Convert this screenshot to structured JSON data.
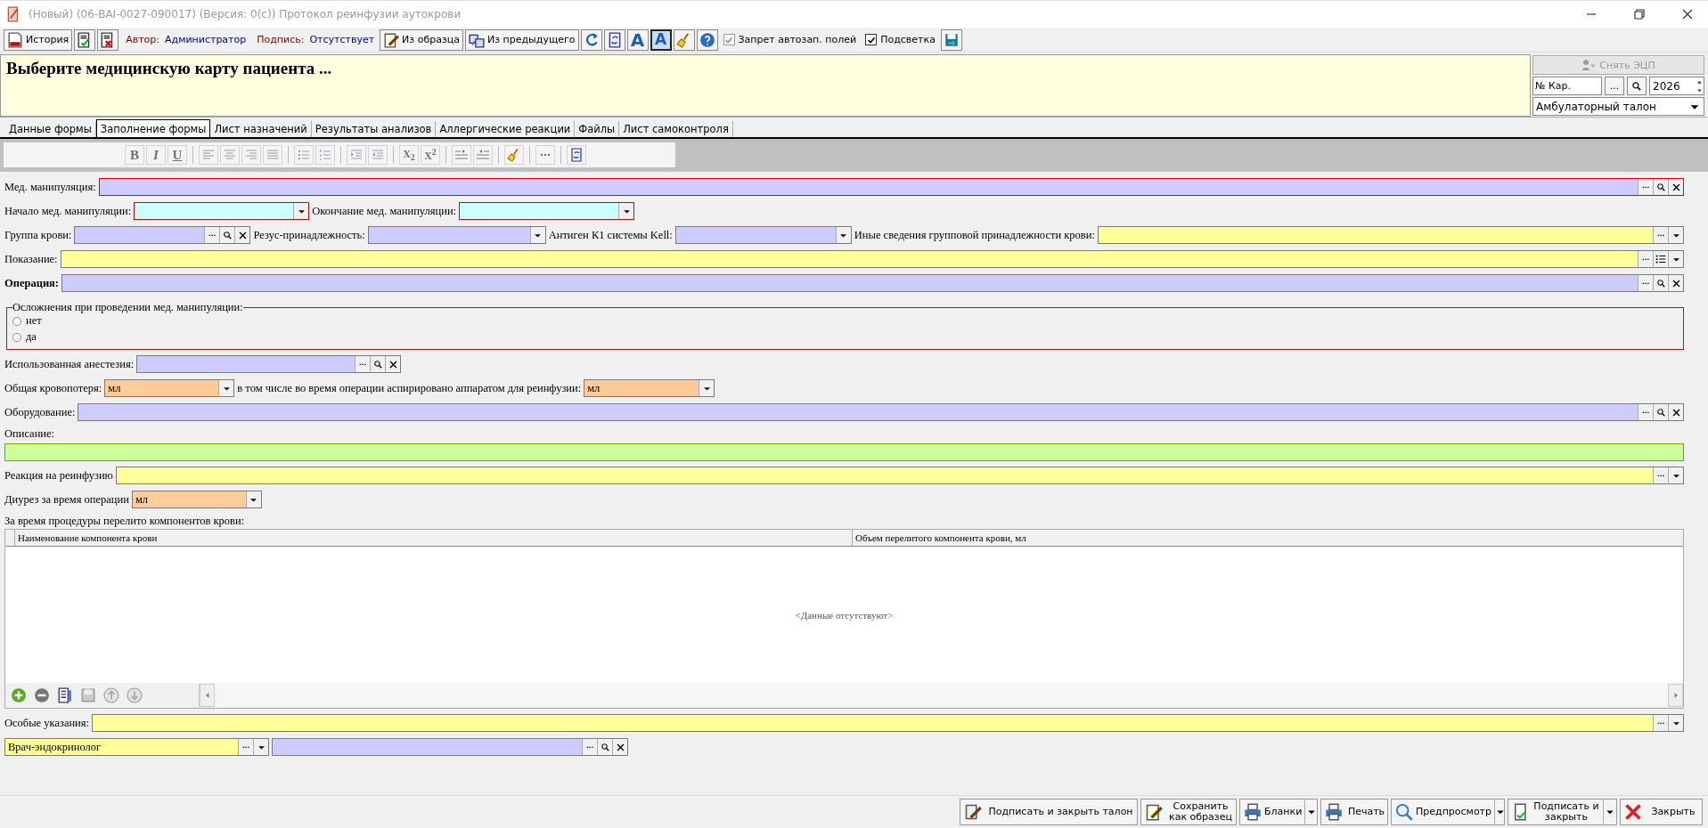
{
  "window": {
    "title": "(Новый) (06-BAI-0027-090017) (Версия: 0(с)) Протокол реинфузии аутокрови"
  },
  "toolbar": {
    "items": [
      {
        "kind": "button",
        "label": "История"
      },
      {
        "kind": "icon"
      },
      {
        "kind": "icon"
      },
      {
        "kind": "info",
        "label": "Автор:",
        "value": "Администратор"
      },
      {
        "kind": "info",
        "label": "Подпись:",
        "value": "Отсутствует"
      },
      {
        "kind": "button",
        "label": "Из образца"
      },
      {
        "kind": "button",
        "label": "Из предыдущего"
      },
      {
        "kind": "icon"
      },
      {
        "kind": "icon"
      },
      {
        "kind": "glyph",
        "label": "A",
        "pressed": false
      },
      {
        "kind": "glyph",
        "label": "A",
        "pressed": true
      },
      {
        "kind": "icon"
      },
      {
        "kind": "icon"
      },
      {
        "kind": "check",
        "label": "Запрет автозап. полей",
        "checked": true,
        "disabled": true
      },
      {
        "kind": "check",
        "label": "Подсветка",
        "checked": true,
        "disabled": false
      },
      {
        "kind": "icon"
      }
    ]
  },
  "header": {
    "message": "Выберите медицинскую карту пациента ...",
    "unsign": {
      "label": "Снять ЭЦП",
      "disabled": true
    },
    "card_placeholder": "№ Кар.",
    "browse_label": "...",
    "year": "2026",
    "ticket_type": "Амбулаторный талон"
  },
  "tabs": [
    {
      "label": "Данные формы",
      "selected": false
    },
    {
      "label": "Заполнение формы",
      "selected": true
    },
    {
      "label": "Лист назначений",
      "selected": false
    },
    {
      "label": "Результаты анализов",
      "selected": false
    },
    {
      "label": "Аллергические реакции",
      "selected": false
    },
    {
      "label": "Файлы",
      "selected": false
    },
    {
      "label": "Лист самоконтроля",
      "selected": false
    }
  ],
  "format_toolbar": {
    "disabled": true,
    "buttons": [
      {
        "kind": "text",
        "label": "B"
      },
      {
        "kind": "text",
        "label": "I"
      },
      {
        "kind": "text",
        "label": "U"
      },
      {
        "kind": "icon"
      },
      {
        "kind": "icon"
      },
      {
        "kind": "icon"
      },
      {
        "kind": "icon"
      },
      {
        "kind": "icon"
      },
      {
        "kind": "icon"
      },
      {
        "kind": "icon"
      },
      {
        "kind": "icon"
      },
      {
        "kind": "text",
        "label": "X$_{2}$"
      },
      {
        "kind": "text",
        "label": "X$^{2}$"
      },
      {
        "kind": "icon"
      },
      {
        "kind": "icon"
      },
      {
        "kind": "icon"
      },
      {
        "kind": "icon"
      },
      {
        "kind": "icon"
      }
    ]
  },
  "form": [
    {
      "kind": "row",
      "parts": [
        {
          "label": "Мед. манипуляция:",
          "field": {
            "kind": "lookup",
            "required": true
          }
        }
      ]
    },
    {
      "kind": "row",
      "parts": [
        {
          "label": "Начало мед. манипуляции:",
          "field": {
            "kind": "date",
            "required": true
          }
        },
        {
          "label": "Окончание мед. манипуляции:",
          "field": {
            "kind": "date",
            "required": true
          }
        }
      ]
    },
    {
      "kind": "row",
      "parts": [
        {
          "label": "Группа крови:",
          "field": {
            "kind": "lookup",
            "required": false
          }
        },
        {
          "label": "Резус-принадлежность:",
          "field": {
            "kind": "combo",
            "required": false
          }
        },
        {
          "label": "Антиген К1 системы Kell:",
          "field": {
            "kind": "combo",
            "required": false
          }
        },
        {
          "label": "Иные сведения групповой принадлежности крови:",
          "field": {
            "kind": "dict",
            "required": false
          }
        }
      ]
    },
    {
      "kind": "row",
      "parts": [
        {
          "label": "Показание:",
          "field": {
            "kind": "dictlist",
            "required": false
          }
        }
      ]
    },
    {
      "kind": "row",
      "parts": [
        {
          "label": "Операция:",
          "bold": true,
          "field": {
            "kind": "lookup",
            "required": false
          }
        }
      ]
    },
    {
      "kind": "radio_group",
      "title": "Осложнения при проведении мед. манипуляции:",
      "required": true,
      "options": [
        {
          "label": "нет",
          "selected": false
        },
        {
          "label": "да",
          "selected": false
        }
      ]
    },
    {
      "kind": "row",
      "parts": [
        {
          "label": "Использованная анестезия:",
          "field": {
            "kind": "lookup",
            "required": false
          }
        }
      ]
    },
    {
      "kind": "row",
      "parts": [
        {
          "label": "Общая кровопотеря:",
          "field": {
            "kind": "unit",
            "required": false,
            "value": "мл"
          }
        },
        {
          "label": "в том числе во время операции аспирировано аппаратом для реинфузии:",
          "field": {
            "kind": "unit",
            "required": false,
            "value": "мл"
          }
        }
      ]
    },
    {
      "kind": "row",
      "parts": [
        {
          "label": "Оборудование:",
          "field": {
            "kind": "lookup",
            "required": false
          }
        }
      ]
    },
    {
      "kind": "stacked",
      "label": "Описание:",
      "field": {
        "kind": "memo",
        "required": false
      }
    },
    {
      "kind": "row",
      "parts": [
        {
          "label": "Реакция на реинфузию",
          "field": {
            "kind": "dict",
            "required": false
          }
        }
      ]
    },
    {
      "kind": "row",
      "parts": [
        {
          "label": "Диурез за время операции",
          "field": {
            "kind": "unit",
            "required": false,
            "value": "мл"
          }
        }
      ]
    },
    {
      "kind": "table",
      "caption": "За время процедуры перелито компонентов крови:",
      "columns": [
        "Наименование компонента крови",
        "Объем перелитого компонента крови, мл"
      ],
      "empty_text": "<Данные отсутствуют>"
    },
    {
      "kind": "row",
      "parts": [
        {
          "label": "Особые указания:",
          "field": {
            "kind": "dict",
            "required": false
          }
        }
      ]
    },
    {
      "kind": "row",
      "parts": [
        {
          "field": {
            "kind": "dict",
            "required": false,
            "value": "Врач-эндокринолог"
          }
        },
        {
          "field": {
            "kind": "lookup",
            "required": false
          }
        }
      ]
    }
  ],
  "footer": {
    "buttons": [
      {
        "label": "Подписать и закрыть талон",
        "menu": false
      },
      {
        "label": "Сохранить как образец",
        "menu": false
      },
      {
        "label": "Бланки",
        "menu": true
      },
      {
        "label": "Печать",
        "menu": false
      },
      {
        "label": "Предпросмотр",
        "menu": true
      },
      {
        "label": "Подписать и закрыть",
        "menu": true
      },
      {
        "label": "Закрыть",
        "menu": false
      }
    ]
  }
}
